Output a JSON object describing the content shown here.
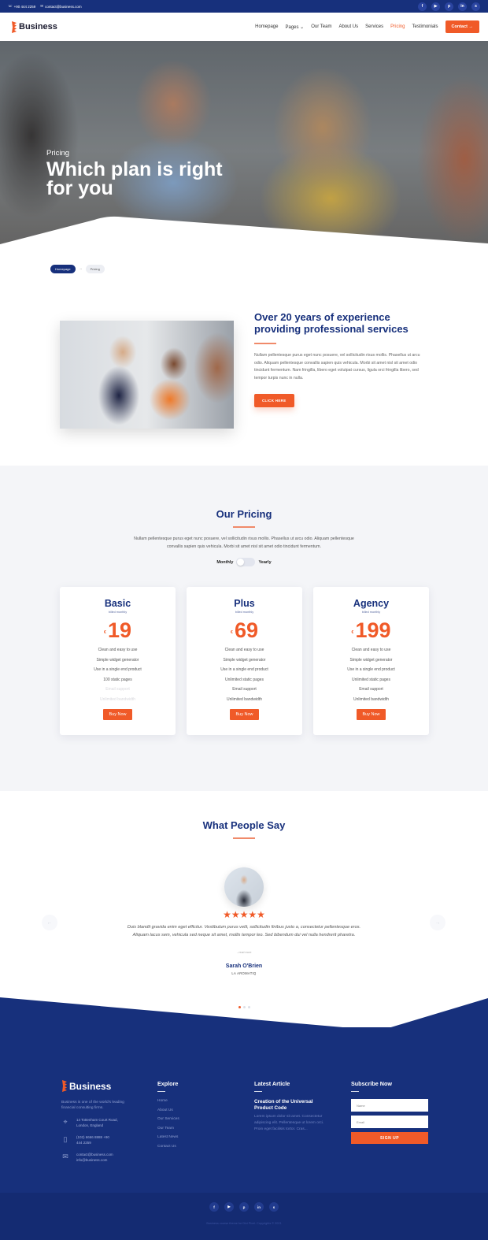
{
  "topbar": {
    "phone": "+90 444 2259",
    "email": "contact@business.com",
    "socials": [
      {
        "icon": "facebook-icon",
        "glyph": "f"
      },
      {
        "icon": "youtube-icon",
        "glyph": "▶"
      },
      {
        "icon": "pinterest-icon",
        "glyph": "p"
      },
      {
        "icon": "linkedin-icon",
        "glyph": "in"
      },
      {
        "icon": "skype-icon",
        "glyph": "s"
      }
    ]
  },
  "header": {
    "logo_text": "Business",
    "nav": [
      {
        "label": "Homepage",
        "active": false
      },
      {
        "label": "Pages ⌄",
        "active": false
      },
      {
        "label": "Our Team",
        "active": false
      },
      {
        "label": "About Us",
        "active": false
      },
      {
        "label": "Services",
        "active": false
      },
      {
        "label": "Pricing",
        "active": true
      },
      {
        "label": "Testimonials",
        "active": false
      }
    ],
    "contact_button": "Contact →"
  },
  "hero": {
    "kicker": "Pricing",
    "title": "Which plan is right for you"
  },
  "breadcrumb": {
    "home": "Homepage",
    "separator": "→",
    "current": "Pricing"
  },
  "about": {
    "title": "Over 20 years of experience providing professional services",
    "paragraph": "Nullam pellentesque purus eget nunc posuere, vel sollicitudin risus mollis. Phasellus ut arcu odio. Aliquam pellentesque convallis sapien quis vehicula. Morbi sit amet nisl sit amet odio tincidunt fermentum. Nam fringilla, libero eget volutpat cursus, ligula orci fringilla libero, sed tempor turpis nunc in nulla.",
    "button": "CLICK HERE"
  },
  "pricing": {
    "title": "Our Pricing",
    "description": "Nullam pellentesque purus eget nunc posuere, vel sollicitudin risus mollis. Phasellus ut arcu odio. Aliquam pellentesque convallis sapien quis vehicula. Morbi sit amet nisl sit amet odio tincidunt fermentum.",
    "toggle": {
      "left": "Monthly",
      "right": "Yearly",
      "selected": "Monthly"
    },
    "plans": [
      {
        "name": "Basic",
        "billed": "billed monthly",
        "currency": "€",
        "price": "19",
        "features": [
          {
            "text": "Clean and easy to use",
            "included": true
          },
          {
            "text": "Simple widget generator",
            "included": true
          },
          {
            "text": "Use in a single end product",
            "included": true
          },
          {
            "text": "100 static pages",
            "included": true
          },
          {
            "text": "Email support",
            "included": false
          },
          {
            "text": "Unlimited bandwidth",
            "included": false
          }
        ],
        "button": "Buy Now"
      },
      {
        "name": "Plus",
        "billed": "billed monthly",
        "currency": "€",
        "price": "69",
        "features": [
          {
            "text": "Clean and easy to use",
            "included": true
          },
          {
            "text": "Simple widget generator",
            "included": true
          },
          {
            "text": "Use in a single end product",
            "included": true
          },
          {
            "text": "Unlimited static pages",
            "included": true
          },
          {
            "text": "Email support",
            "included": true
          },
          {
            "text": "Unlimited bandwidth",
            "included": true
          }
        ],
        "button": "Buy Now"
      },
      {
        "name": "Agency",
        "billed": "billed monthly",
        "currency": "€",
        "price": "199",
        "features": [
          {
            "text": "Clean and easy to use",
            "included": true
          },
          {
            "text": "Simple widget generator",
            "included": true
          },
          {
            "text": "Use in a single end product",
            "included": true
          },
          {
            "text": "Unlimited static pages",
            "included": true
          },
          {
            "text": "Email support",
            "included": true
          },
          {
            "text": "Unlimited bandwidth",
            "included": true
          }
        ],
        "button": "Buy Now"
      }
    ]
  },
  "testimonials": {
    "title": "What People Say",
    "rating": 5,
    "stars": "★★★★★",
    "quote": "Duis blandit gravida enim eget efficitur. Vestibulum purus velit, sollicitudin finibus justo a, consectetur pellentesque eros. Aliquam lacus sem, vehicula sed neque sit amet, mollis tempor leo. Sed bibendum dui vel nulla hendrerit pharetra.",
    "read_more": "...read more",
    "name": "Sarah O'Brien",
    "company": "LA AROMATIQ",
    "prev_arrow": "←",
    "next_arrow": "→",
    "slides": 3,
    "active_slide": 1
  },
  "footer": {
    "logo_text": "Business",
    "about": "Business is one of the world's leading financial consulting firms.",
    "contacts": [
      {
        "icon": "map-pin-icon",
        "glyph": "⌖",
        "lines": "14 Tottenham Court Road, London, England"
      },
      {
        "icon": "phone-icon",
        "glyph": "▯",
        "lines": "(102) 6666 8888 +90 444 2259"
      },
      {
        "icon": "envelope-icon",
        "glyph": "✉",
        "lines": "contact@business.com info@business.com"
      }
    ],
    "explore": {
      "title": "Explore",
      "links": [
        "Home",
        "About Us",
        "Our Services",
        "Our Team",
        "Latest News",
        "Contact Us"
      ]
    },
    "article": {
      "title": "Latest Article",
      "headline": "Creation of the Universal Product Code",
      "excerpt": "Lorem ipsum dolor sit amet. Consectetur adipiscing elit. Pellentesque ut lorem orci. Proin eget facilisis tortor. Cras..."
    },
    "subscribe": {
      "title": "Subscribe Now",
      "name_placeholder": "Name",
      "email_placeholder": "Email",
      "button": "SIGN UP"
    },
    "socials": [
      {
        "icon": "facebook-icon",
        "glyph": "f"
      },
      {
        "icon": "youtube-icon",
        "glyph": "▶"
      },
      {
        "icon": "pinterest-icon",
        "glyph": "p"
      },
      {
        "icon": "linkedin-icon",
        "glyph": "in"
      },
      {
        "icon": "skype-icon",
        "glyph": "s"
      }
    ],
    "copyright": "Business course theme for Divi Pixel. Copyrights © 2021"
  },
  "colors": {
    "brand_blue": "#17307c",
    "accent_orange": "#f05a28",
    "section_bg": "#f4f5f8"
  }
}
